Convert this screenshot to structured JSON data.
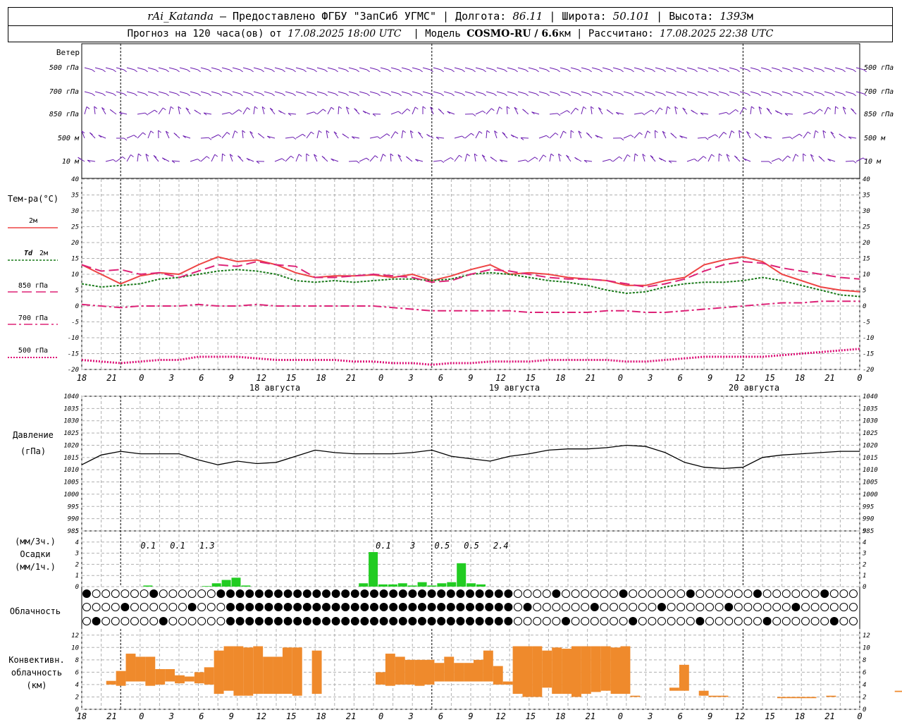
{
  "header": {
    "station": "rAi_Katanda",
    "dash": "—",
    "provided": "Предоставлено ФГБУ \"ЗапСиб УГМС\"",
    "lon_label": "Долгота:",
    "lon": "86.11",
    "lat_label": "Широта:",
    "lat": "50.101",
    "alt_label": "Высота:",
    "alt": "1393",
    "alt_unit": "м",
    "forecast_label": "Прогноз на 120 часа(ов) от",
    "forecast_time": "17.08.2025 18:00 UTC",
    "model_label": "Модель",
    "model": "COSMO-RU / 6.6",
    "model_unit": "км",
    "calc_label": "Рассчитано:",
    "calc_time": "17.08.2025 22:38 UTC"
  },
  "labels": {
    "wind": "Ветер",
    "temp": "Тем-ра(°C)",
    "t2m": "2м",
    "td": "Td",
    "td2m": "2м",
    "p850": "850 гПа",
    "p700": "700 гПа",
    "p500": "500 гПа",
    "pressure1": "Давление",
    "pressure2": "(гПа)",
    "precip1": "(мм/3ч.)",
    "precip2": "Осадки",
    "precip3": "(мм/1ч.)",
    "cloud": "Облачность",
    "conv1": "Конвективн.",
    "conv2": "облачность",
    "conv3": "(км)"
  },
  "wind_levels": [
    "500 гПа",
    "700 гПа",
    "850 гПа",
    "500 м",
    "10 м"
  ],
  "x_ticks": [
    "18",
    "21",
    "0",
    "3",
    "6",
    "9",
    "12",
    "15",
    "18",
    "21",
    "0",
    "3",
    "6",
    "9",
    "12",
    "15",
    "18",
    "21",
    "0",
    "3",
    "6",
    "9",
    "12",
    "15",
    "18",
    "21",
    "0"
  ],
  "dates": [
    "18 августа",
    "19 августа",
    "20 августа"
  ],
  "colors": {
    "t2m": "#ee4444",
    "td": "#1a7a1a",
    "p850": "#dd2277",
    "p700": "#dd2277",
    "p500": "#dd1177",
    "pressure": "#000000",
    "wind": "#6a1ab0",
    "precip": "#22cc22",
    "conv": "#ef8a2c",
    "grid": "#b0b0b0"
  },
  "chart_data": [
    {
      "type": "line",
      "title": "Тем-ра(°C)",
      "x_hours": [
        0,
        3,
        6,
        9,
        12,
        15,
        18,
        21,
        24,
        27,
        30,
        33,
        36,
        39,
        42,
        45,
        48,
        51,
        54,
        57,
        60,
        63,
        66,
        69,
        72,
        75,
        78,
        81,
        84,
        87,
        90,
        93,
        96,
        99,
        102,
        105,
        108,
        111,
        114,
        117,
        120
      ],
      "ylim": [
        -20,
        40
      ],
      "yticks": [
        -20,
        -15,
        -10,
        -5,
        0,
        5,
        10,
        15,
        20,
        25,
        30,
        35,
        40
      ],
      "series": [
        {
          "name": "2м",
          "key": "t2m",
          "values": [
            13,
            10,
            7,
            9.5,
            10.5,
            10,
            13,
            15.5,
            14,
            14.5,
            13,
            10.5,
            9,
            9.5,
            9.5,
            9.8,
            9,
            10,
            8,
            9.5,
            11.5,
            13,
            10,
            10.5,
            10,
            9,
            8.5,
            8,
            6.5,
            6.5,
            8,
            9,
            13,
            14.5,
            15.5,
            14,
            10,
            8,
            6,
            5,
            4.5
          ]
        },
        {
          "name": "Td 2м",
          "key": "td",
          "values": [
            7,
            6,
            6.5,
            7,
            8.5,
            9,
            10,
            11,
            11.5,
            11,
            10,
            8,
            7.5,
            8,
            7.5,
            8,
            8.5,
            8.5,
            8,
            8.5,
            10,
            10.5,
            10,
            9,
            8,
            7.5,
            6.5,
            5,
            4,
            4.5,
            6,
            7,
            7.5,
            7.5,
            8,
            9,
            8,
            6.5,
            5,
            3.5,
            3
          ]
        },
        {
          "name": "850 гПа",
          "key": "p850",
          "values": [
            13,
            11,
            11.5,
            10,
            10.5,
            9,
            11,
            13,
            12.5,
            14,
            13,
            12.5,
            9,
            9,
            9.5,
            10,
            9.5,
            9,
            7.5,
            8,
            10,
            11.5,
            11,
            10,
            9,
            8.5,
            8.5,
            8,
            7,
            6,
            7,
            8.5,
            11,
            13,
            14,
            13.5,
            12,
            11,
            10,
            9,
            8.5
          ]
        },
        {
          "name": "700 гПа",
          "key": "p700",
          "values": [
            0.5,
            0,
            -0.5,
            0,
            0,
            0,
            0.5,
            0,
            0,
            0.5,
            0,
            0,
            0,
            0,
            0,
            0,
            -0.5,
            -1,
            -1.5,
            -1.5,
            -1.5,
            -1.5,
            -1.5,
            -2,
            -2,
            -2,
            -2,
            -1.5,
            -1.5,
            -2,
            -2,
            -1.5,
            -1,
            -0.5,
            0,
            0.5,
            1,
            1,
            1.5,
            1.5,
            1.5
          ]
        },
        {
          "name": "500 гПа",
          "key": "p500",
          "values": [
            -17,
            -17.5,
            -18,
            -17.5,
            -17,
            -17,
            -16,
            -16,
            -16,
            -16.5,
            -17,
            -17,
            -17,
            -17,
            -17.5,
            -17.5,
            -18,
            -18,
            -18.5,
            -18,
            -18,
            -17.5,
            -17.5,
            -17.5,
            -17,
            -17,
            -17,
            -17,
            -17.5,
            -17.5,
            -17,
            -16.5,
            -16,
            -16,
            -16,
            -16,
            -15.5,
            -15,
            -14.5,
            -14,
            -13.5
          ]
        }
      ]
    },
    {
      "type": "line",
      "title": "Давление (гПа)",
      "x_hours": [
        0,
        3,
        6,
        9,
        12,
        15,
        18,
        21,
        24,
        27,
        30,
        33,
        36,
        39,
        42,
        45,
        48,
        51,
        54,
        57,
        60,
        63,
        66,
        69,
        72,
        75,
        78,
        81,
        84,
        87,
        90,
        93,
        96,
        99,
        102,
        105,
        108,
        111,
        114,
        117,
        120
      ],
      "ylim": [
        985,
        1040
      ],
      "yticks": [
        985,
        990,
        995,
        1000,
        1005,
        1010,
        1015,
        1020,
        1025,
        1030,
        1035,
        1040
      ],
      "series": [
        {
          "name": "Давление",
          "key": "pressure",
          "values": [
            1012,
            1016,
            1017.5,
            1016.5,
            1016.5,
            1016.5,
            1014,
            1012,
            1013.5,
            1012.5,
            1013,
            1015.5,
            1018,
            1017,
            1016.5,
            1016.5,
            1016.5,
            1017,
            1018,
            1015.5,
            1014.5,
            1013.5,
            1015.5,
            1016.5,
            1018,
            1018.5,
            1018.5,
            1019,
            1020,
            1019.5,
            1017,
            1013,
            1011,
            1010.5,
            1011,
            1015,
            1016,
            1016.5,
            1017,
            1017.5,
            1017.5
          ]
        }
      ]
    },
    {
      "type": "bar",
      "title": "Осадки",
      "ylim": [
        0,
        5
      ],
      "yticks": [
        0,
        1,
        2,
        3,
        4,
        5
      ],
      "x_hours": [
        1,
        2,
        3,
        4,
        5,
        6,
        7,
        8,
        9,
        10,
        11,
        12,
        13,
        14,
        15,
        16,
        17,
        18,
        19,
        20,
        21,
        22,
        23,
        24
      ],
      "values_1h": [
        0.05,
        0.05,
        0.05,
        0.05,
        0.05,
        0.05,
        0.05,
        0.05,
        0.05,
        0.05,
        0.05,
        0.05,
        0.05,
        0.05,
        0.05,
        0.05,
        0.05,
        0.05,
        0.05,
        0.05,
        0.05,
        0.05,
        0.05,
        0.05
      ],
      "bars": [
        {
          "h": 7,
          "v": 0.1
        },
        {
          "h": 13,
          "v": 0.05
        },
        {
          "h": 14,
          "v": 0.3
        },
        {
          "h": 15,
          "v": 0.6
        },
        {
          "h": 16,
          "v": 0.8
        },
        {
          "h": 17,
          "v": 0.1
        },
        {
          "h": 29,
          "v": 0.3
        },
        {
          "h": 30,
          "v": 3.1
        },
        {
          "h": 31,
          "v": 0.2
        },
        {
          "h": 32,
          "v": 0.2
        },
        {
          "h": 33,
          "v": 0.3
        },
        {
          "h": 34,
          "v": 0.1
        },
        {
          "h": 35,
          "v": 0.4
        },
        {
          "h": 36,
          "v": 0.1
        },
        {
          "h": 37,
          "v": 0.3
        },
        {
          "h": 38,
          "v": 0.4
        },
        {
          "h": 39,
          "v": 2.1
        },
        {
          "h": 40,
          "v": 0.3
        },
        {
          "h": 41,
          "v": 0.2
        }
      ],
      "labels_3h": [
        {
          "h": 7.5,
          "text": "0.1"
        },
        {
          "h": 10.5,
          "text": "0.1"
        },
        {
          "h": 13.5,
          "text": "1.3"
        },
        {
          "h": 31.5,
          "text": "0.1"
        },
        {
          "h": 34.5,
          "text": "3"
        },
        {
          "h": 37.5,
          "text": "0.5"
        },
        {
          "h": 40.5,
          "text": "0.5"
        },
        {
          "h": 43.5,
          "text": "2.4"
        }
      ]
    },
    {
      "type": "bar",
      "title": "Конвективн. облачность (км)",
      "ylim": [
        0,
        13
      ],
      "yticks": [
        0,
        2,
        4,
        6,
        8,
        10,
        12
      ],
      "bars": [
        {
          "h0": 2.5,
          "h1": 3.5,
          "lo": 4,
          "hi": 4.6
        },
        {
          "h0": 3.5,
          "h1": 4.5,
          "lo": 3.8,
          "hi": 6.2
        },
        {
          "h0": 4.5,
          "h1": 5.5,
          "lo": 4.5,
          "hi": 9
        },
        {
          "h0": 5.5,
          "h1": 6.5,
          "lo": 4.5,
          "hi": 8.5
        },
        {
          "h0": 6.5,
          "h1": 7.5,
          "lo": 3.8,
          "hi": 8.5
        },
        {
          "h0": 7.5,
          "h1": 8.5,
          "lo": 4,
          "hi": 6.5
        },
        {
          "h0": 8.5,
          "h1": 9.5,
          "lo": 4.5,
          "hi": 6.5
        },
        {
          "h0": 9.5,
          "h1": 10.5,
          "lo": 4.2,
          "hi": 5.5
        },
        {
          "h0": 10.5,
          "h1": 11.5,
          "lo": 4.5,
          "hi": 5.3
        },
        {
          "h0": 11.5,
          "h1": 12.5,
          "lo": 4.2,
          "hi": 6
        },
        {
          "h0": 12.5,
          "h1": 13.5,
          "lo": 4,
          "hi": 6.8
        },
        {
          "h0": 13.5,
          "h1": 14.5,
          "lo": 2.5,
          "hi": 9.5
        },
        {
          "h0": 14.5,
          "h1": 15.5,
          "lo": 3,
          "hi": 10.2
        },
        {
          "h0": 15.5,
          "h1": 16.5,
          "lo": 2.2,
          "hi": 10.2
        },
        {
          "h0": 16.5,
          "h1": 17.5,
          "lo": 2.2,
          "hi": 10
        },
        {
          "h0": 17.5,
          "h1": 18.5,
          "lo": 2.5,
          "hi": 10.2
        },
        {
          "h0": 18.5,
          "h1": 19.5,
          "lo": 2.5,
          "hi": 8.5
        },
        {
          "h0": 19.5,
          "h1": 20.5,
          "lo": 2.5,
          "hi": 8.5
        },
        {
          "h0": 20.5,
          "h1": 21.5,
          "lo": 2.5,
          "hi": 10
        },
        {
          "h0": 21.5,
          "h1": 22.5,
          "lo": 2.2,
          "hi": 10
        },
        {
          "h0": 23.5,
          "h1": 24.5,
          "lo": 2.5,
          "hi": 9.5
        },
        {
          "h0": 30,
          "h1": 31,
          "lo": 4,
          "hi": 6
        },
        {
          "h0": 31,
          "h1": 32,
          "lo": 3.8,
          "hi": 9
        },
        {
          "h0": 32,
          "h1": 33,
          "lo": 4,
          "hi": 8.5
        },
        {
          "h0": 33,
          "h1": 34,
          "lo": 4,
          "hi": 8
        },
        {
          "h0": 34,
          "h1": 35,
          "lo": 3.8,
          "hi": 8
        },
        {
          "h0": 35,
          "h1": 36,
          "lo": 4,
          "hi": 8
        },
        {
          "h0": 36,
          "h1": 37,
          "lo": 4.5,
          "hi": 7.5
        },
        {
          "h0": 37,
          "h1": 38,
          "lo": 4.5,
          "hi": 8.5
        },
        {
          "h0": 38,
          "h1": 39,
          "lo": 4.5,
          "hi": 7.5
        },
        {
          "h0": 39,
          "h1": 40,
          "lo": 4.5,
          "hi": 7.5
        },
        {
          "h0": 40,
          "h1": 41,
          "lo": 4.5,
          "hi": 8
        },
        {
          "h0": 41,
          "h1": 42,
          "lo": 4.5,
          "hi": 9.5
        },
        {
          "h0": 42,
          "h1": 43,
          "lo": 4,
          "hi": 7
        },
        {
          "h0": 43,
          "h1": 44,
          "lo": 4,
          "hi": 4.5
        },
        {
          "h0": 44,
          "h1": 45,
          "lo": 2.5,
          "hi": 10.2
        },
        {
          "h0": 45,
          "h1": 46,
          "lo": 2,
          "hi": 10.2
        },
        {
          "h0": 46,
          "h1": 47,
          "lo": 2,
          "hi": 10.2
        },
        {
          "h0": 47,
          "h1": 48,
          "lo": 3.5,
          "hi": 9.5
        },
        {
          "h0": 48,
          "h1": 49,
          "lo": 2.5,
          "hi": 10
        },
        {
          "h0": 49,
          "h1": 50,
          "lo": 2.5,
          "hi": 9.8
        },
        {
          "h0": 50,
          "h1": 51,
          "lo": 2,
          "hi": 10.2
        },
        {
          "h0": 51,
          "h1": 52,
          "lo": 2.5,
          "hi": 10.2
        },
        {
          "h0": 52,
          "h1": 53,
          "lo": 2.8,
          "hi": 10.2
        },
        {
          "h0": 53,
          "h1": 54,
          "lo": 3,
          "hi": 10.2
        },
        {
          "h0": 54,
          "h1": 55,
          "lo": 2.5,
          "hi": 10
        },
        {
          "h0": 55,
          "h1": 56,
          "lo": 2.5,
          "hi": 10.2
        },
        {
          "h0": 56,
          "h1": 57,
          "lo": 2,
          "hi": 2.2
        },
        {
          "h0": 60,
          "h1": 61,
          "lo": 3,
          "hi": 3.5
        },
        {
          "h0": 61,
          "h1": 62,
          "lo": 3,
          "hi": 7.2
        },
        {
          "h0": 63,
          "h1": 64,
          "lo": 2.2,
          "hi": 3
        },
        {
          "h0": 64,
          "h1": 65,
          "lo": 2,
          "hi": 2.2
        },
        {
          "h0": 65,
          "h1": 66,
          "lo": 2,
          "hi": 2.2
        },
        {
          "h0": 71,
          "h1": 72,
          "lo": 1.8,
          "hi": 2
        },
        {
          "h0": 72,
          "h1": 73,
          "lo": 1.8,
          "hi": 2
        },
        {
          "h0": 73,
          "h1": 74,
          "lo": 1.8,
          "hi": 2
        },
        {
          "h0": 74,
          "h1": 75,
          "lo": 1.8,
          "hi": 2
        },
        {
          "h0": 76,
          "h1": 77,
          "lo": 2,
          "hi": 2.2
        },
        {
          "h0": 83,
          "h1": 84,
          "lo": 2.8,
          "hi": 3
        }
      ]
    }
  ]
}
